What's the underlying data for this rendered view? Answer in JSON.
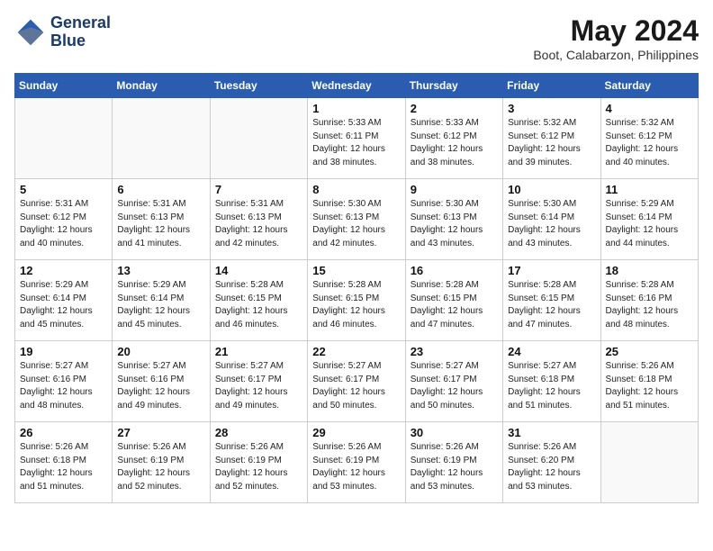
{
  "header": {
    "logo_line1": "General",
    "logo_line2": "Blue",
    "month_title": "May 2024",
    "location": "Boot, Calabarzon, Philippines"
  },
  "days_of_week": [
    "Sunday",
    "Monday",
    "Tuesday",
    "Wednesday",
    "Thursday",
    "Friday",
    "Saturday"
  ],
  "weeks": [
    [
      {
        "day": "",
        "info": ""
      },
      {
        "day": "",
        "info": ""
      },
      {
        "day": "",
        "info": ""
      },
      {
        "day": "1",
        "info": "Sunrise: 5:33 AM\nSunset: 6:11 PM\nDaylight: 12 hours\nand 38 minutes."
      },
      {
        "day": "2",
        "info": "Sunrise: 5:33 AM\nSunset: 6:12 PM\nDaylight: 12 hours\nand 38 minutes."
      },
      {
        "day": "3",
        "info": "Sunrise: 5:32 AM\nSunset: 6:12 PM\nDaylight: 12 hours\nand 39 minutes."
      },
      {
        "day": "4",
        "info": "Sunrise: 5:32 AM\nSunset: 6:12 PM\nDaylight: 12 hours\nand 40 minutes."
      }
    ],
    [
      {
        "day": "5",
        "info": "Sunrise: 5:31 AM\nSunset: 6:12 PM\nDaylight: 12 hours\nand 40 minutes."
      },
      {
        "day": "6",
        "info": "Sunrise: 5:31 AM\nSunset: 6:13 PM\nDaylight: 12 hours\nand 41 minutes."
      },
      {
        "day": "7",
        "info": "Sunrise: 5:31 AM\nSunset: 6:13 PM\nDaylight: 12 hours\nand 42 minutes."
      },
      {
        "day": "8",
        "info": "Sunrise: 5:30 AM\nSunset: 6:13 PM\nDaylight: 12 hours\nand 42 minutes."
      },
      {
        "day": "9",
        "info": "Sunrise: 5:30 AM\nSunset: 6:13 PM\nDaylight: 12 hours\nand 43 minutes."
      },
      {
        "day": "10",
        "info": "Sunrise: 5:30 AM\nSunset: 6:14 PM\nDaylight: 12 hours\nand 43 minutes."
      },
      {
        "day": "11",
        "info": "Sunrise: 5:29 AM\nSunset: 6:14 PM\nDaylight: 12 hours\nand 44 minutes."
      }
    ],
    [
      {
        "day": "12",
        "info": "Sunrise: 5:29 AM\nSunset: 6:14 PM\nDaylight: 12 hours\nand 45 minutes."
      },
      {
        "day": "13",
        "info": "Sunrise: 5:29 AM\nSunset: 6:14 PM\nDaylight: 12 hours\nand 45 minutes."
      },
      {
        "day": "14",
        "info": "Sunrise: 5:28 AM\nSunset: 6:15 PM\nDaylight: 12 hours\nand 46 minutes."
      },
      {
        "day": "15",
        "info": "Sunrise: 5:28 AM\nSunset: 6:15 PM\nDaylight: 12 hours\nand 46 minutes."
      },
      {
        "day": "16",
        "info": "Sunrise: 5:28 AM\nSunset: 6:15 PM\nDaylight: 12 hours\nand 47 minutes."
      },
      {
        "day": "17",
        "info": "Sunrise: 5:28 AM\nSunset: 6:15 PM\nDaylight: 12 hours\nand 47 minutes."
      },
      {
        "day": "18",
        "info": "Sunrise: 5:28 AM\nSunset: 6:16 PM\nDaylight: 12 hours\nand 48 minutes."
      }
    ],
    [
      {
        "day": "19",
        "info": "Sunrise: 5:27 AM\nSunset: 6:16 PM\nDaylight: 12 hours\nand 48 minutes."
      },
      {
        "day": "20",
        "info": "Sunrise: 5:27 AM\nSunset: 6:16 PM\nDaylight: 12 hours\nand 49 minutes."
      },
      {
        "day": "21",
        "info": "Sunrise: 5:27 AM\nSunset: 6:17 PM\nDaylight: 12 hours\nand 49 minutes."
      },
      {
        "day": "22",
        "info": "Sunrise: 5:27 AM\nSunset: 6:17 PM\nDaylight: 12 hours\nand 50 minutes."
      },
      {
        "day": "23",
        "info": "Sunrise: 5:27 AM\nSunset: 6:17 PM\nDaylight: 12 hours\nand 50 minutes."
      },
      {
        "day": "24",
        "info": "Sunrise: 5:27 AM\nSunset: 6:18 PM\nDaylight: 12 hours\nand 51 minutes."
      },
      {
        "day": "25",
        "info": "Sunrise: 5:26 AM\nSunset: 6:18 PM\nDaylight: 12 hours\nand 51 minutes."
      }
    ],
    [
      {
        "day": "26",
        "info": "Sunrise: 5:26 AM\nSunset: 6:18 PM\nDaylight: 12 hours\nand 51 minutes."
      },
      {
        "day": "27",
        "info": "Sunrise: 5:26 AM\nSunset: 6:19 PM\nDaylight: 12 hours\nand 52 minutes."
      },
      {
        "day": "28",
        "info": "Sunrise: 5:26 AM\nSunset: 6:19 PM\nDaylight: 12 hours\nand 52 minutes."
      },
      {
        "day": "29",
        "info": "Sunrise: 5:26 AM\nSunset: 6:19 PM\nDaylight: 12 hours\nand 53 minutes."
      },
      {
        "day": "30",
        "info": "Sunrise: 5:26 AM\nSunset: 6:19 PM\nDaylight: 12 hours\nand 53 minutes."
      },
      {
        "day": "31",
        "info": "Sunrise: 5:26 AM\nSunset: 6:20 PM\nDaylight: 12 hours\nand 53 minutes."
      },
      {
        "day": "",
        "info": ""
      }
    ]
  ]
}
